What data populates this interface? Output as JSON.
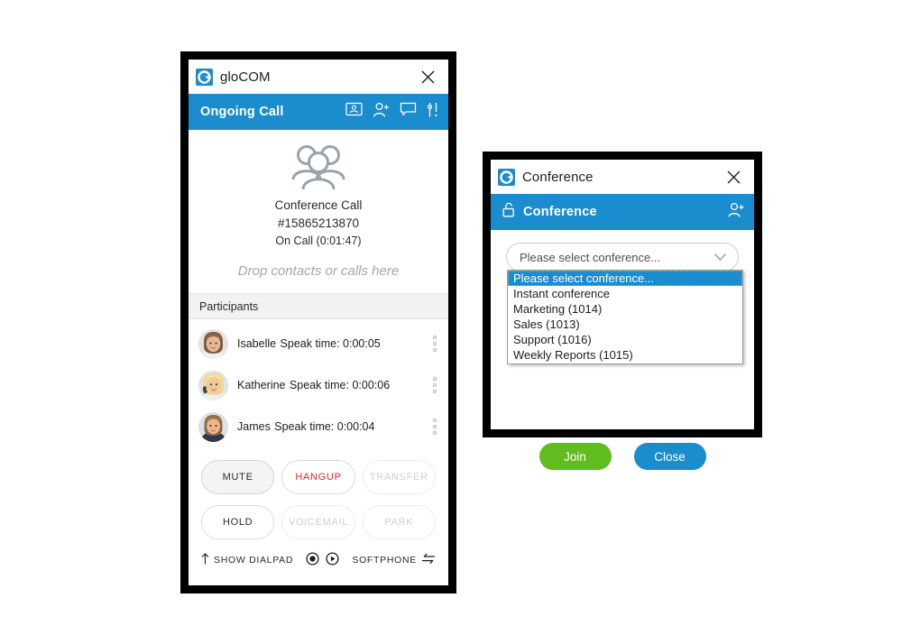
{
  "theme": {
    "accent_blue": "#1b8cce",
    "join_green": "#61bd1f",
    "hangup_red": "#e8222a",
    "disabled_gray": "#cfcfcf",
    "section_gray": "#f2f2f2"
  },
  "glocom_window": {
    "title": "gloCOM",
    "logo_letter": "G",
    "close_label": "Close",
    "action_bar": {
      "title": "Ongoing Call",
      "icons": [
        {
          "name": "video-conference-icon",
          "label": "Video conference"
        },
        {
          "name": "add-participant-icon",
          "label": "Add participant"
        },
        {
          "name": "chat-icon",
          "label": "Chat"
        },
        {
          "name": "settings-sliders-icon",
          "label": "Settings"
        }
      ]
    },
    "call": {
      "icon": "group-call-icon",
      "name": "Conference Call",
      "number": "#15865213870",
      "status": "On Call (0:01:47)",
      "drop_hint": "Drop contacts or calls here"
    },
    "participants_section": {
      "header": "Participants",
      "items": [
        {
          "name": "Isabelle",
          "speak_time": "Speak time: 0:00:05",
          "avatar": "avatar-isabelle"
        },
        {
          "name": "Katherine",
          "speak_time": "Speak time: 0:00:06",
          "avatar": "avatar-katherine"
        },
        {
          "name": "James",
          "speak_time": "Speak time: 0:00:04",
          "avatar": "avatar-james"
        }
      ]
    },
    "controls": [
      {
        "label": "MUTE",
        "state": "active"
      },
      {
        "label": "HANGUP",
        "state": "danger"
      },
      {
        "label": "TRANSFER",
        "state": "disabled"
      },
      {
        "label": "HOLD",
        "state": "normal"
      },
      {
        "label": "VOICEMAIL",
        "state": "disabled"
      },
      {
        "label": "PARK",
        "state": "disabled"
      }
    ],
    "bottom_bar": {
      "show_dialpad": "SHOW DIALPAD",
      "show_dialpad_icon": "arrow-up-icon",
      "record_icon": "record-icon",
      "play_icon": "play-icon",
      "softphone": "SOFTPHONE",
      "softphone_icon": "swap-arrows-icon"
    }
  },
  "conference_window": {
    "title": "Conference",
    "logo_letter": "G",
    "close_label": "Close",
    "action_bar": {
      "title": "Conference",
      "lock_icon": "unlocked-padlock-icon",
      "add_icon": "add-participant-icon"
    },
    "combo": {
      "value": "Please select conference...",
      "arrow_icon": "chevron-down-icon",
      "options": [
        {
          "label": "Please select conference...",
          "selected": true
        },
        {
          "label": "Instant conference",
          "selected": false
        },
        {
          "label": "Marketing (1014)",
          "selected": false
        },
        {
          "label": "Sales (1013)",
          "selected": false
        },
        {
          "label": "Support (1016)",
          "selected": false
        },
        {
          "label": "Weekly Reports (1015)",
          "selected": false
        }
      ]
    },
    "buttons": {
      "join": "Join",
      "close": "Close"
    }
  }
}
